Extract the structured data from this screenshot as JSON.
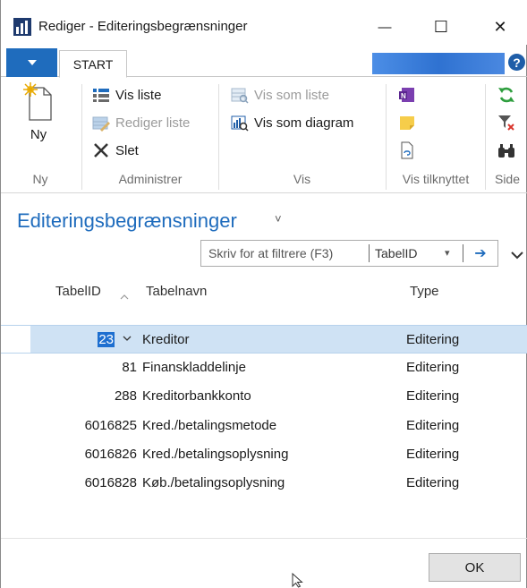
{
  "window": {
    "title": "Rediger - Editeringsbegrænsninger",
    "minimize_symbol": "—",
    "maximize_symbol": "☐",
    "close_symbol": "✕"
  },
  "ribbon": {
    "tabs": [
      {
        "label": "START",
        "active": true
      }
    ],
    "help_symbol": "?",
    "groups": {
      "ny": {
        "label": "Ny",
        "buttons": [
          {
            "label": "Ny",
            "icon": "new-document-icon",
            "enabled": true
          }
        ]
      },
      "administrer": {
        "label": "Administrer",
        "buttons": [
          {
            "label": "Vis liste",
            "icon": "view-list-icon",
            "enabled": true
          },
          {
            "label": "Rediger liste",
            "icon": "edit-list-icon",
            "enabled": false
          },
          {
            "label": "Slet",
            "icon": "delete-icon",
            "enabled": true
          }
        ]
      },
      "vis": {
        "label": "Vis",
        "buttons": [
          {
            "label": "Vis som liste",
            "icon": "show-as-list-icon",
            "enabled": false
          },
          {
            "label": "Vis som diagram",
            "icon": "show-as-chart-icon",
            "enabled": true
          }
        ]
      },
      "vis_tilknyttet": {
        "label": "Vis tilknyttet",
        "buttons": [
          {
            "icon": "onenote-icon"
          },
          {
            "icon": "notes-icon"
          },
          {
            "icon": "links-icon"
          }
        ]
      },
      "side": {
        "label": "Side",
        "buttons": [
          {
            "icon": "refresh-icon"
          },
          {
            "icon": "clear-filter-icon"
          },
          {
            "icon": "find-icon"
          }
        ]
      }
    }
  },
  "page": {
    "title": "Editeringsbegrænsninger",
    "title_menu_symbol": "˅",
    "filter": {
      "placeholder": "Skriv for at filtrere (F3)",
      "field": "TabelID",
      "dropdown_symbol": "▾",
      "go_symbol": "➔"
    }
  },
  "grid": {
    "columns": [
      "TabelID",
      "Tabelnavn",
      "Type"
    ],
    "sort_column": "TabelID",
    "rows": [
      {
        "id": "23",
        "name": "Kreditor",
        "type": "Editering",
        "selected": true
      },
      {
        "id": "81",
        "name": "Finanskladdelinje",
        "type": "Editering",
        "selected": false
      },
      {
        "id": "288",
        "name": "Kreditorbankkonto",
        "type": "Editering",
        "selected": false
      },
      {
        "id": "6016825",
        "name": "Kred./betalingsmetode",
        "type": "Editering",
        "selected": false
      },
      {
        "id": "6016826",
        "name": "Kred./betalingsoplysning",
        "type": "Editering",
        "selected": false
      },
      {
        "id": "6016828",
        "name": "Køb./betalingsoplysning",
        "type": "Editering",
        "selected": false
      }
    ]
  },
  "footer": {
    "ok_label": "OK"
  },
  "colors": {
    "accent": "#1f6cbd",
    "selection": "#cfe2f4",
    "highlight": "#1e6fd0"
  }
}
